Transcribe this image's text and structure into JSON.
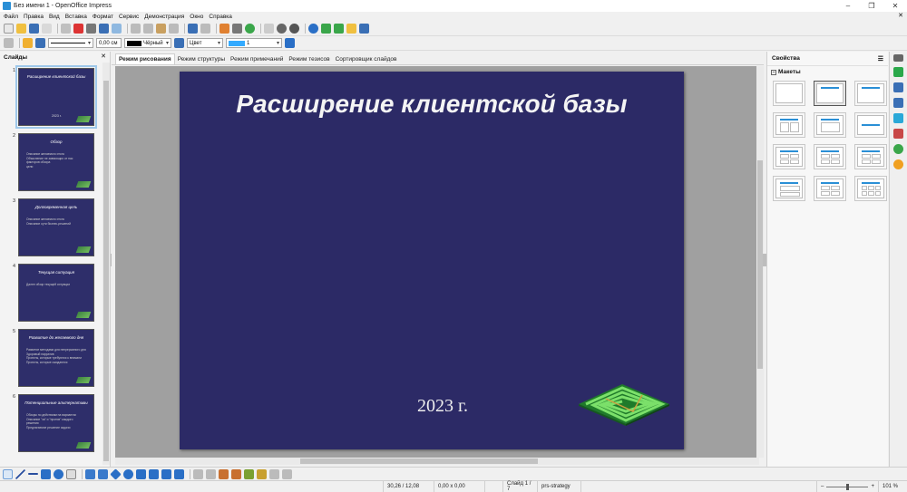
{
  "window": {
    "title": "Без имени 1 - OpenOffice Impress",
    "controls": [
      "–",
      "❐",
      "✕"
    ]
  },
  "menu": [
    "Файл",
    "Правка",
    "Вид",
    "Вставка",
    "Формат",
    "Сервис",
    "Демонстрация",
    "Окно",
    "Справка"
  ],
  "menu_close": "✕",
  "toolbar2": {
    "line_width": "0,00 см",
    "line_color": "Чёрный",
    "fill_type": "Цвет",
    "fill_color": "1"
  },
  "slides_panel": {
    "title": "Слайды",
    "close": "✕",
    "slides": [
      {
        "num": "1",
        "title": "Расширение клиентской базы",
        "bullets": [],
        "year": "2023 г.",
        "selected": true
      },
      {
        "num": "2",
        "title": "Обзор",
        "bullets": [
          "Описание желаемого итога",
          "Объяснение не зависящих от нас",
          "факторов обзора",
          "цели"
        ]
      },
      {
        "num": "3",
        "title": "Долговременная цель",
        "bullets": [
          "Описание желаемого итога",
          "Описание сути бизнес-решений"
        ]
      },
      {
        "num": "4",
        "title": "Текущая ситуация",
        "bullets": [
          "Далее обзор текущей ситуации"
        ]
      },
      {
        "num": "5",
        "title": "Развитие до желаемого дня",
        "bullets": [
          "Развитие методами для непрерывного дня",
          "Здоровый нарратив",
          "Проекты, которые требуются к внимани",
          "Проекты, которые ожидаются"
        ]
      },
      {
        "num": "6",
        "title": "Потенциальные альтернативы",
        "bullets": [
          "Обзоры по действиям на вариантах",
          "Описание \"за\" и \"против\" каждого",
          "решения",
          "Предлагаемое решение задачи"
        ]
      }
    ]
  },
  "view_tabs": [
    "Режим рисования",
    "Режим структуры",
    "Режим примечаний",
    "Режим тезисов",
    "Сортировщик слайдов"
  ],
  "active_tab": 0,
  "slide": {
    "title": "Расширение клиентской базы",
    "year": "2023 г."
  },
  "properties": {
    "title": "Свойства",
    "menu": "☰",
    "section": "Макеты",
    "layouts_count": 12,
    "selected_layout": 1
  },
  "status": {
    "position": "30,26 / 12,08",
    "size": "0,00 x 0,00",
    "slide": "Слайд 1 / 7",
    "master": "prs-strategy",
    "zoom": "101 %"
  },
  "colors": {
    "slide_bg": "#2c2a66",
    "accent": "#2a8fd6",
    "logo_green": "#3aa64a"
  }
}
